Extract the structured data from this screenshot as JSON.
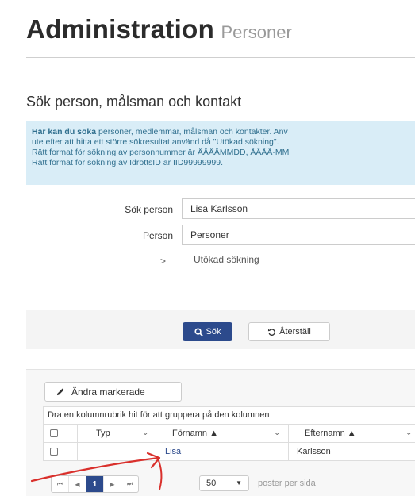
{
  "page": {
    "title": "Administration",
    "subtitle": "Personer"
  },
  "search_section": {
    "title": "Sök person, målsman och kontakt",
    "info": {
      "line1_strong": "Här kan du söka",
      "line1_rest": " personer, medlemmar, målsmän och kontakter. Anv",
      "line2": "ute efter att hitta ett större sökresultat använd då \"Utökad sökning\".",
      "line3": "Rätt format för sökning av personnummer är ÅÅÅÅMMDD, ÅÅÅÅ-MM",
      "line4": "Rätt format för sökning av IdrottsID är IID99999999."
    },
    "fields": {
      "search_person_label": "Sök person",
      "search_person_value": "Lisa Karlsson",
      "person_label": "Person",
      "person_value": "Personer"
    },
    "extended_chevron": ">",
    "extended_link": "Utökad sökning",
    "search_button": "Sök",
    "reset_button": "Återställ"
  },
  "grid": {
    "edit_button": "Ändra markerade",
    "group_hint": "Dra en kolumnrubrik hit för att gruppera på den kolumnen",
    "columns": {
      "type": "Typ",
      "firstname": "Förnamn ▲",
      "lastname": "Efternamn ▲"
    },
    "rows": [
      {
        "type": "",
        "firstname": "Lisa",
        "lastname": "Karlsson"
      }
    ],
    "pager": {
      "first": "⏮",
      "prev": "◀",
      "current_page": "1",
      "next": "▶",
      "last": "⏭",
      "page_size": "50",
      "page_size_label": "poster per sida"
    }
  },
  "colors": {
    "primary": "#2c4a8c",
    "info_bg": "#d9edf7",
    "info_text": "#31708f",
    "annotation_arrow": "#d9302c"
  },
  "icons": {
    "search": "magnifier-icon",
    "reset": "undo-icon",
    "edit": "pencil-icon"
  }
}
